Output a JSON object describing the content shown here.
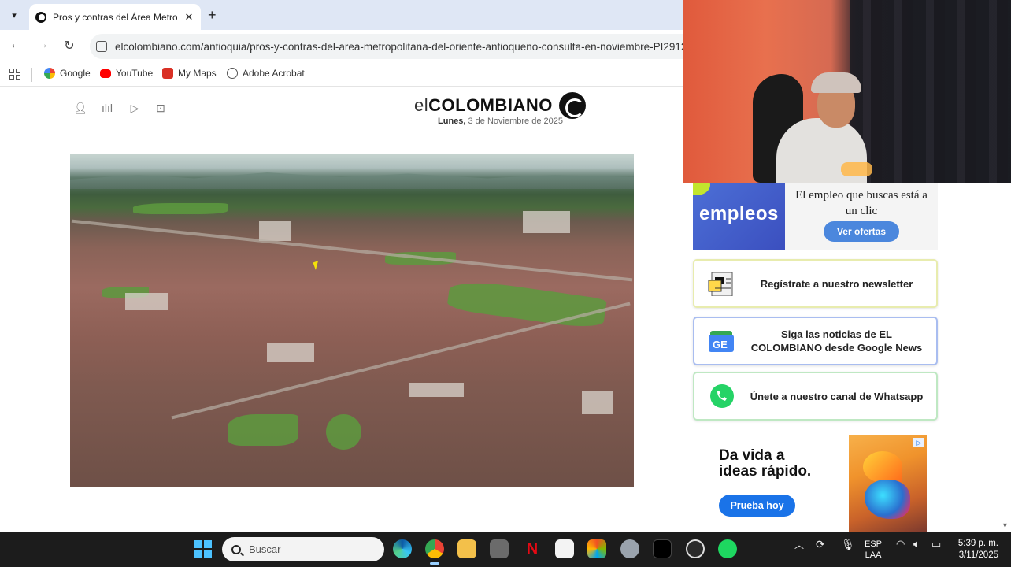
{
  "browser": {
    "tab_title": "Pros y contras del Área Metropolitana",
    "url": "elcolombiano.com/antioquia/pros-y-contras-del-area-metropolitana-del-oriente-antioqueno-consulta-en-noviembre-PI2912",
    "bookmarks": [
      {
        "label": "Google",
        "color": "#4285f4"
      },
      {
        "label": "YouTube",
        "color": "#ff0000"
      },
      {
        "label": "My Maps",
        "color": "#d93025"
      },
      {
        "label": "Adobe Acrobat",
        "color": "#555555"
      }
    ]
  },
  "site": {
    "logo_prefix": "el",
    "logo_brand": "COLOMBIANO",
    "date_day": "Lunes,",
    "date_rest": " 3 de Noviembre de 2025"
  },
  "sidebar": {
    "promo": {
      "brand": "empleos",
      "text": "El empleo que buscas está a un clic",
      "button": "Ver ofertas"
    },
    "cards": [
      {
        "text": "Regístrate a nuestro newsletter",
        "border": "#e8ecae",
        "icon": "newsletter-icon"
      },
      {
        "text": "Siga las noticias de EL COLOMBIANO desde Google News",
        "border": "#a9bdf0",
        "icon": "google-news-icon"
      },
      {
        "text": "Únete a nuestro canal de Whatsapp",
        "border": "#bfe8c3",
        "icon": "whatsapp-icon"
      }
    ],
    "ad": {
      "headline_1": "Da vida a",
      "headline_2": "ideas rápido.",
      "button": "Prueba hoy"
    }
  },
  "taskbar": {
    "search_placeholder": "Buscar",
    "lang_1": "ESP",
    "lang_2": "LAA",
    "time": "5:39 p. m.",
    "date": "3/11/2025"
  }
}
